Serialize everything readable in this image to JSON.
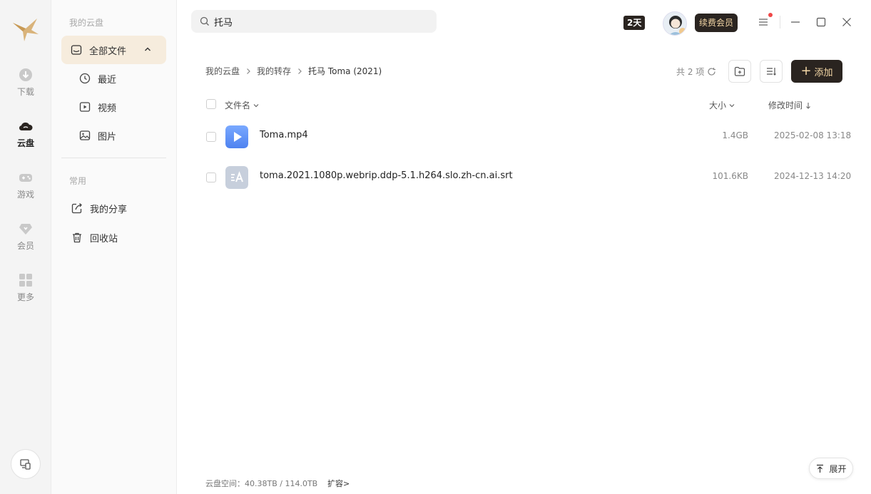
{
  "rail": {
    "items": [
      {
        "label": "下载",
        "icon": "download-icon"
      },
      {
        "label": "云盘",
        "icon": "cloud-icon"
      },
      {
        "label": "游戏",
        "icon": "gamepad-icon"
      },
      {
        "label": "会员",
        "icon": "diamond-icon"
      },
      {
        "label": "更多",
        "icon": "apps-grid-icon"
      }
    ],
    "active": "云盘"
  },
  "sidebar": {
    "section_title": "我的云盘",
    "all_files": "全部文件",
    "items": [
      "最近",
      "视频",
      "图片"
    ],
    "common_title": "常用",
    "common_items": [
      "我的分享",
      "回收站"
    ]
  },
  "search": {
    "value": "托马"
  },
  "header": {
    "days_badge": "2天",
    "renew_label": "续费会员"
  },
  "breadcrumb": [
    "我的云盘",
    "我的转存",
    "托马 Toma (2021)"
  ],
  "toolbar": {
    "count": "共 2 项",
    "add_label": "添加"
  },
  "columns": {
    "name": "文件名",
    "size": "大小",
    "modified": "修改时间"
  },
  "files": [
    {
      "name": "Toma.mp4",
      "size": "1.4GB",
      "modified": "2025-02-08 13:18",
      "type": "video"
    },
    {
      "name": "toma.2021.1080p.webrip.ddp-5.1.h264.slo.zh-cn.ai.srt",
      "size": "101.6KB",
      "modified": "2024-12-13 14:20",
      "type": "subtitle"
    }
  ],
  "footer": {
    "storage": "云盘空间：40.38TB / 114.0TB",
    "expand": "扩容>",
    "unfold": "展开"
  },
  "colors": {
    "accent_dark": "#2a2420",
    "accent_gold": "#f4d7a6",
    "active_bg": "#f6ecdd"
  }
}
